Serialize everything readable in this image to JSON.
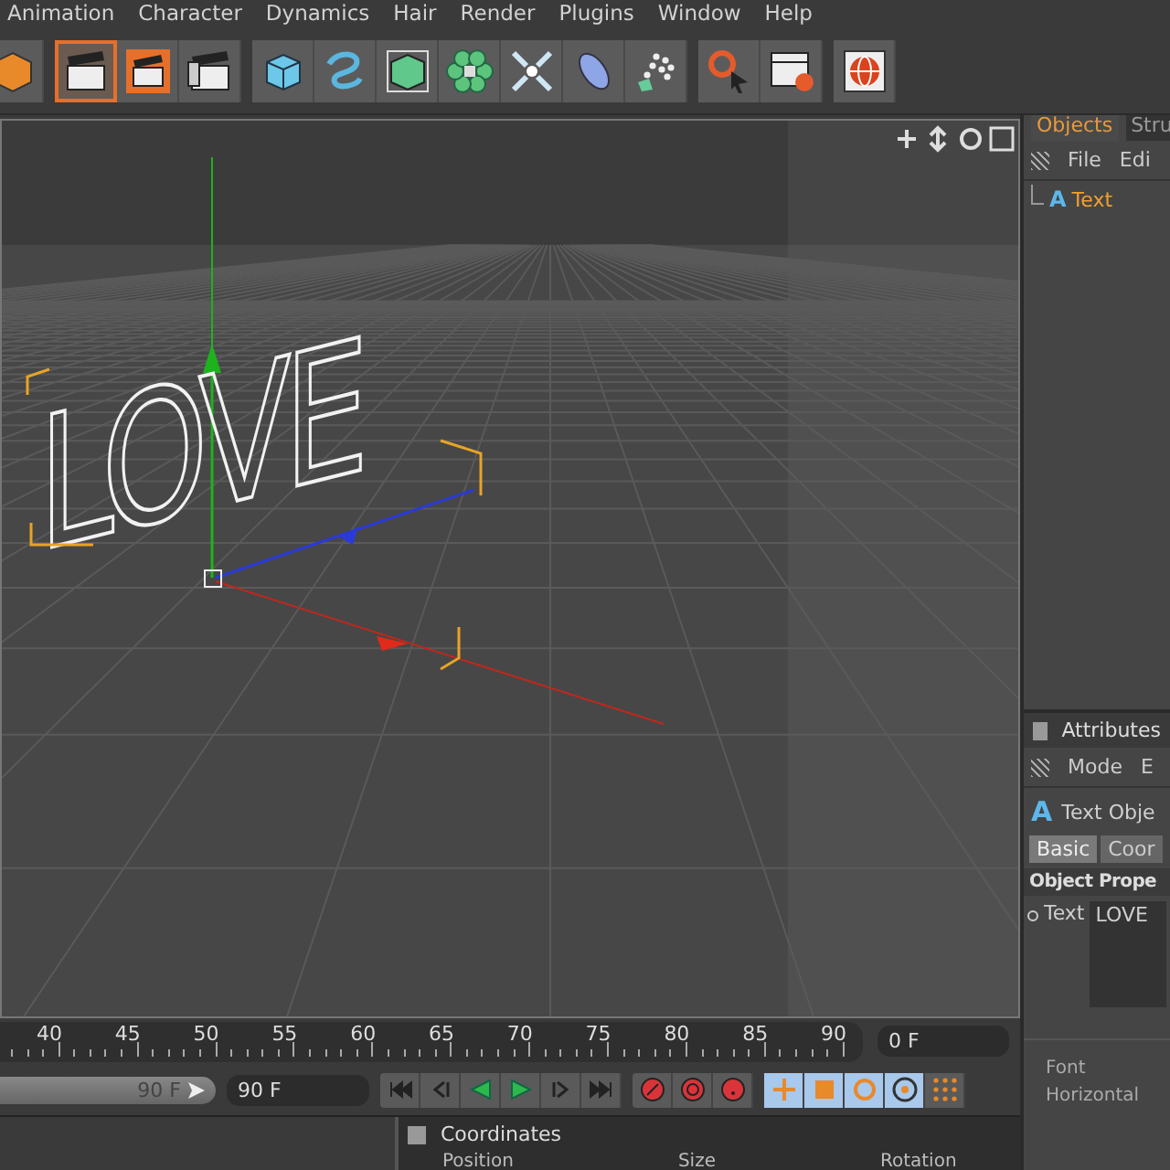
{
  "menu": [
    "Animation",
    "Character",
    "Dynamics",
    "Hair",
    "Render",
    "Plugins",
    "Window",
    "Help"
  ],
  "toolbar": [
    [
      {
        "kind": "cube-orange",
        "selected": false
      }
    ],
    [
      {
        "kind": "clapper",
        "selected": true
      },
      {
        "kind": "clapper-orange",
        "selected": false
      },
      {
        "kind": "clapper-stack",
        "selected": false
      }
    ],
    [
      {
        "kind": "cube",
        "selected": false
      },
      {
        "kind": "spline",
        "selected": false
      },
      {
        "kind": "green-cube",
        "selected": false
      },
      {
        "kind": "flower",
        "selected": false
      },
      {
        "kind": "arrows",
        "selected": false
      },
      {
        "kind": "lens",
        "selected": false
      },
      {
        "kind": "dots",
        "selected": false
      }
    ],
    [
      {
        "kind": "help-cursor",
        "selected": false
      },
      {
        "kind": "table-help",
        "selected": false
      }
    ],
    [
      {
        "kind": "globe",
        "selected": false
      }
    ]
  ],
  "viewport": {
    "scene_text": "LOVE"
  },
  "timeline": {
    "ticks": [
      "40",
      "45",
      "50",
      "55",
      "60",
      "65",
      "70",
      "75",
      "80",
      "85",
      "90"
    ],
    "current_frame": "0 F"
  },
  "transport": {
    "end_slider": "90 F",
    "level": 1,
    "end_field": "90 F",
    "buttons": [
      {
        "kind": "first"
      },
      {
        "kind": "prev-key"
      },
      {
        "kind": "reverse"
      },
      {
        "kind": "play"
      },
      {
        "kind": "next-key"
      },
      {
        "kind": "last"
      }
    ],
    "record": [
      {
        "kind": "key"
      },
      {
        "kind": "auto"
      },
      {
        "kind": "help"
      }
    ],
    "modes": [
      {
        "kind": "move",
        "selected": true
      },
      {
        "kind": "scale",
        "selected": true
      },
      {
        "kind": "rotate",
        "selected": true
      },
      {
        "kind": "param",
        "selected": true
      },
      {
        "kind": "grid",
        "selected": false
      }
    ]
  },
  "coordinates": {
    "title": "Coordinates",
    "columns": [
      "Position",
      "Size",
      "Rotation"
    ]
  },
  "objects": {
    "tabs": [
      {
        "label": "Objects",
        "selected": true
      },
      {
        "label": "Stru",
        "selected": false
      }
    ],
    "menu": [
      "File",
      "Edi"
    ],
    "items": [
      {
        "label": "Text",
        "glyph": "A",
        "selected": true
      }
    ]
  },
  "attributes": {
    "title": "Attributes",
    "menu": [
      "Mode",
      "E"
    ],
    "object_glyph": "A",
    "object_name": "Text Obje",
    "tabs": [
      {
        "label": "Basic",
        "selected": true
      },
      {
        "label": "Coor",
        "selected": false
      }
    ],
    "section": "Object Prope",
    "text_label": "Text",
    "text_value": "LOVE",
    "fields": [
      "Font",
      "Horizontal"
    ]
  }
}
